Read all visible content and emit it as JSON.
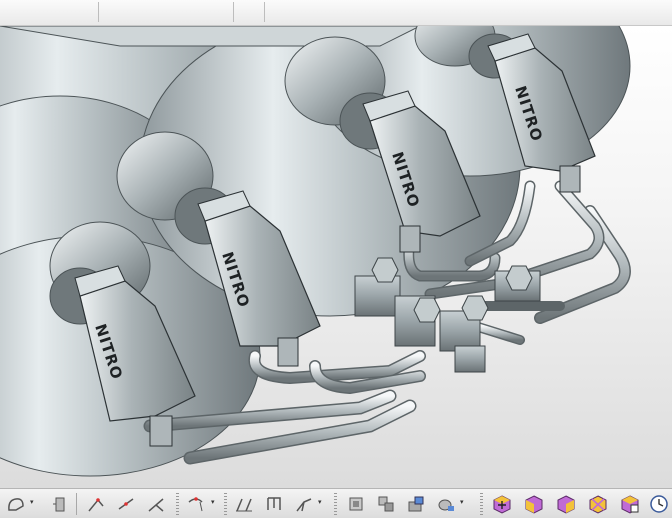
{
  "viewport": {
    "part_labels": [
      "NITRO",
      "NITRO",
      "NITRO",
      "NITRO"
    ]
  },
  "toolbar": {
    "buttons": [
      "sketch-icon",
      "sketch-dropdown-icon",
      "extrude-icon",
      "line-icon",
      "slash-line-icon",
      "line-split-icon",
      "point-icon",
      "point-dropdown-icon",
      "break-icon",
      "trim-icon",
      "connect-icon",
      "constraint-dropdown-icon",
      "transform-icon",
      "project-icon",
      "measure-icon",
      "analysis-icon",
      "analysis-dropdown-icon",
      "iso-view-icon",
      "front-view-icon",
      "right-view-icon",
      "top-view-icon",
      "named-view-icon",
      "clock-icon"
    ],
    "colors": {
      "view_cube": "#c06bd6",
      "view_cube_face": "#f3c23a",
      "toolbar_bg": "#e6e6e6"
    }
  }
}
